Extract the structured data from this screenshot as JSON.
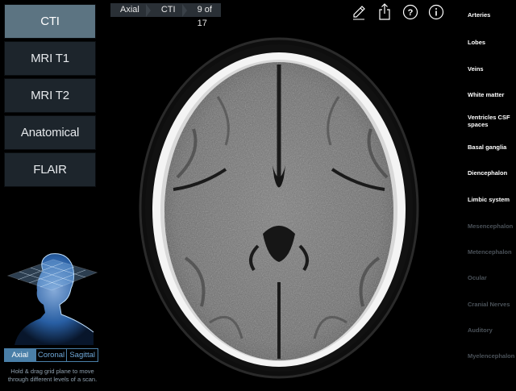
{
  "modalities": [
    {
      "label": "CTI",
      "active": true
    },
    {
      "label": "MRI T1",
      "active": false
    },
    {
      "label": "MRI T2",
      "active": false
    },
    {
      "label": "Anatomical",
      "active": false
    },
    {
      "label": "FLAIR",
      "active": false
    }
  ],
  "breadcrumb": {
    "plane": "Axial",
    "modality": "CTI",
    "slice": "9 of 17"
  },
  "toolbar": {
    "icons": [
      "pencil-icon",
      "share-icon",
      "help-icon",
      "info-icon"
    ]
  },
  "structures": [
    {
      "label": "Arteries",
      "enabled": true
    },
    {
      "label": "Lobes",
      "enabled": true
    },
    {
      "label": "Veins",
      "enabled": true
    },
    {
      "label": "White matter",
      "enabled": true
    },
    {
      "label": "Ventricles CSF spaces",
      "enabled": true
    },
    {
      "label": "Basal ganglia",
      "enabled": true
    },
    {
      "label": "Diencephalon",
      "enabled": true
    },
    {
      "label": "Limbic system",
      "enabled": true
    },
    {
      "label": "Mesencephalon",
      "enabled": false
    },
    {
      "label": "Metencephalon",
      "enabled": false
    },
    {
      "label": "Ocular",
      "enabled": false
    },
    {
      "label": "Cranial Nerves",
      "enabled": false
    },
    {
      "label": "Auditory",
      "enabled": false
    },
    {
      "label": "Myelencephalon",
      "enabled": false
    }
  ],
  "planes": [
    {
      "label": "Axial",
      "active": true
    },
    {
      "label": "Coronal",
      "active": false
    },
    {
      "label": "Sagittal",
      "active": false
    }
  ],
  "hint": "Hold & drag grid plane to move through different levels of a scan.",
  "colors": {
    "active_modality": "#5c7482",
    "modality_bg": "#1d252c",
    "plane_accent": "#4a7fa8"
  }
}
